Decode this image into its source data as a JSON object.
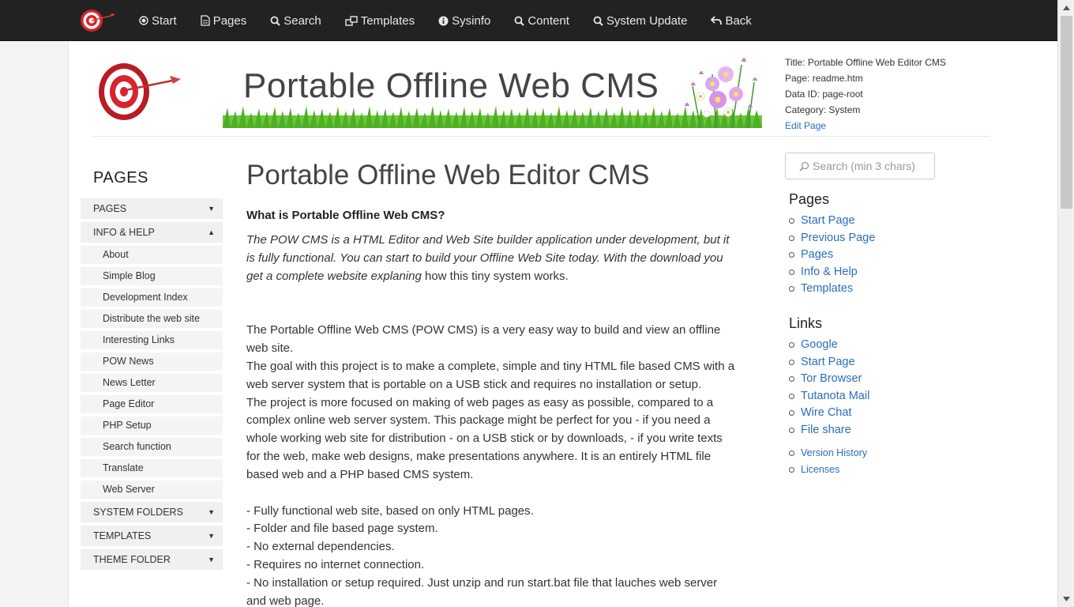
{
  "nav": {
    "items": [
      {
        "label": "Start",
        "icon": "radio-icon"
      },
      {
        "label": "Pages",
        "icon": "file-icon"
      },
      {
        "label": "Search",
        "icon": "search-icon"
      },
      {
        "label": "Templates",
        "icon": "templates-icon"
      },
      {
        "label": "Sysinfo",
        "icon": "info-icon"
      },
      {
        "label": "Content",
        "icon": "search-icon"
      },
      {
        "label": "System Update",
        "icon": "search-icon"
      },
      {
        "label": "Back",
        "icon": "back-arrow-icon"
      }
    ]
  },
  "header": {
    "banner_title": "Portable Offline Web CMS"
  },
  "meta": {
    "title": "Title: Portable Offline Web Editor CMS",
    "page": "Page: readme.htm",
    "data_id": "Data ID: page-root",
    "category": "Category: System",
    "edit_link": "Edit Page"
  },
  "sidebar": {
    "title": "PAGES",
    "groups": [
      {
        "label": "PAGES",
        "caret": "▼"
      },
      {
        "label": "INFO & HELP",
        "caret": "▲"
      }
    ],
    "subitems": [
      "About",
      "Simple Blog",
      "Development Index",
      "Distribute the web site",
      "Interesting Links",
      "POW News",
      "News Letter",
      "Page Editor",
      "PHP Setup",
      "Search function",
      "Translate",
      "Web Server"
    ],
    "groups_after": [
      {
        "label": "SYSTEM FOLDERS",
        "caret": "▼"
      },
      {
        "label": "TEMPLATES",
        "caret": "▼"
      },
      {
        "label": "THEME FOLDER",
        "caret": "▼"
      }
    ]
  },
  "main": {
    "title": "Portable Offline Web Editor CMS",
    "subtitle": "What is Portable Offline Web CMS?",
    "intro_italic": "The POW CMS is a HTML Editor and Web Site builder application under development, but it is fully functional. You can start to build your Offline Web Site today. With the download you get a complete website explaning",
    "intro_rest": " how this tiny system works.",
    "para1": "The Portable Offline Web CMS (POW CMS) is a very easy way to build and view an offline web site.",
    "para2": "The goal with this project is to make a complete, simple and tiny HTML file based CMS with a web server system that is portable on a USB stick and requires no installation or setup.",
    "para3": "The project is more focused on making of web pages as easy as possible, compared to a complex online web server system. This package might be perfect for you - if you need a whole working web site for distribution - on a USB stick or by downloads, - if you write texts for the web, make web designs, make presentations anywhere. It is an entirely HTML file based web and a PHP based CMS system.",
    "features": [
      "- Fully functional web site, based on only HTML pages.",
      "- Folder and file based page system.",
      "- No external dependencies.",
      "- Requires no internet connection.",
      "- No installation or setup required. Just unzip and run start.bat file that lauches web server and web page."
    ]
  },
  "right": {
    "search_placeholder": "Search (min 3 chars)",
    "pages_title": "Pages",
    "pages": [
      "Start Page",
      "Previous Page",
      "Pages",
      "Info & Help",
      "Templates"
    ],
    "links_title": "Links",
    "links": [
      "Google",
      "Start Page",
      "Tor Browser",
      "Tutanota Mail",
      "Wire Chat",
      "File share"
    ],
    "extra": [
      "Version History",
      "Licenses"
    ]
  },
  "colors": {
    "nav_bg": "#222222",
    "link": "#2a6ebb",
    "target_red": "#d9232d"
  }
}
